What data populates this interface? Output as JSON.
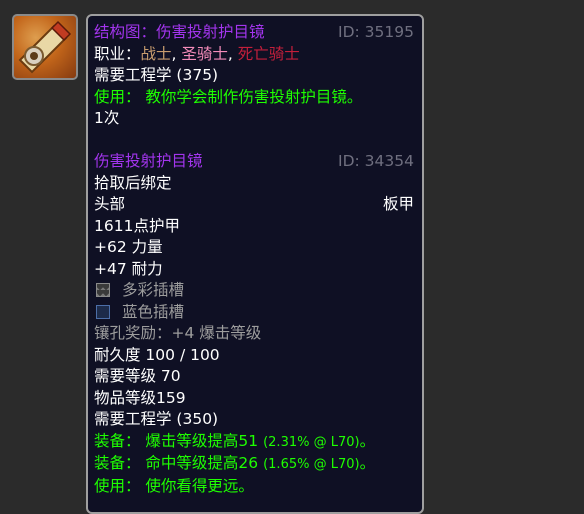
{
  "icon": {
    "name": "blueprint-icon"
  },
  "recipe": {
    "title": "结构图：伤害投射护目镜",
    "id": "ID: 35195",
    "class_prefix": "职业：",
    "classes": [
      "战士",
      "圣骑士",
      "死亡骑士"
    ],
    "class_sep": ", ",
    "requires_skill": "需要工程学 (375)",
    "use": "使用：  教你学会制作伤害投射护目镜。",
    "charges": "1次"
  },
  "item": {
    "name": "伤害投射护目镜",
    "id": "ID: 34354",
    "binding": "拾取后绑定",
    "slot": "头部",
    "armor_type": "板甲",
    "armor": "1611点护甲",
    "stat1": "+62 力量",
    "stat2": "+47 耐力",
    "socket_meta": "多彩插槽",
    "socket_blue": "蓝色插槽",
    "socket_bonus": "镶孔奖励：+4 爆击等级",
    "durability": "耐久度 100 / 100",
    "req_level": "需要等级 70",
    "item_level": "物品等级159",
    "req_skill": "需要工程学 (350)",
    "equip1_label": "装备：  爆击等级提高51",
    "equip1_detail": "(2.31% @ L70)",
    "equip1_end": "。",
    "equip2_label": "装备：  命中等级提高26",
    "equip2_detail": "(1.65% @ L70)",
    "equip2_end": "。",
    "use": "使用：  使你看得更远。"
  }
}
